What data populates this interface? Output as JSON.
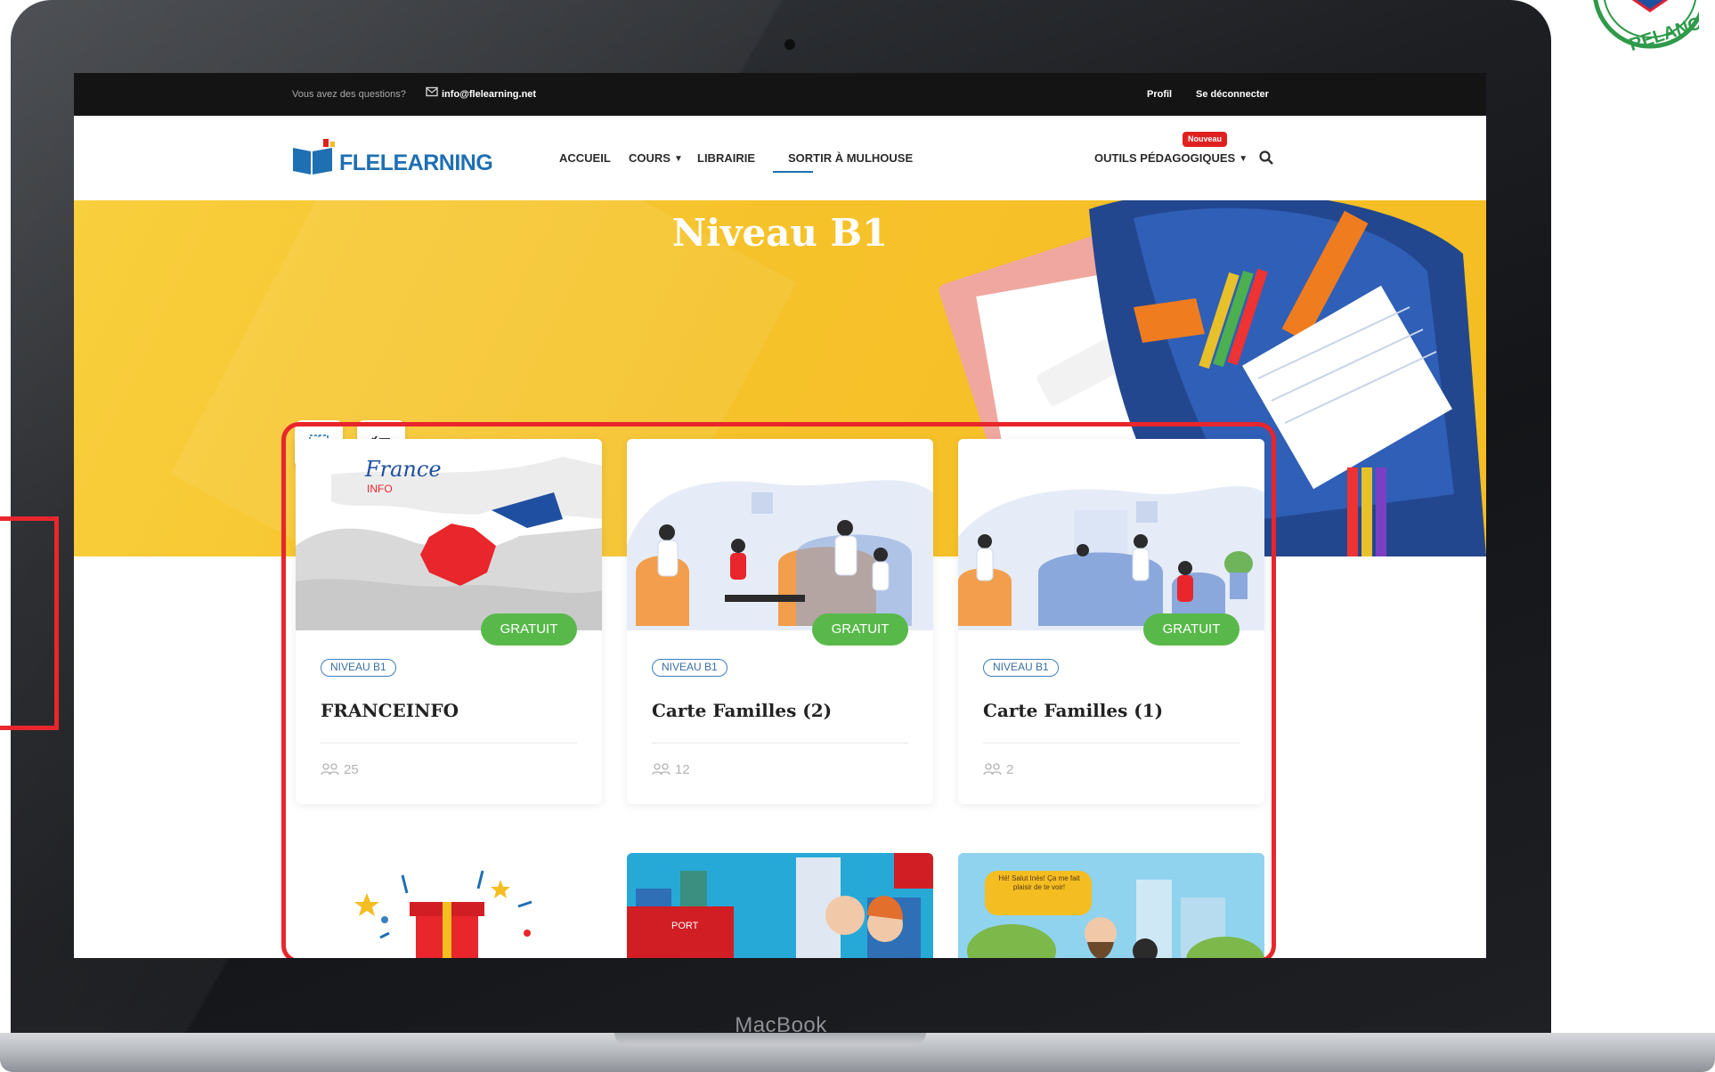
{
  "device": {
    "brand_label": "MacBook"
  },
  "topbar": {
    "question": "Vous avez des questions?",
    "email": "info@flelearning.net",
    "profile_link": "Profil",
    "logout_link": "Se déconnecter"
  },
  "header": {
    "logo_text": "FLELEARNING",
    "nav": [
      {
        "label": "ACCUEIL"
      },
      {
        "label": "COURS"
      },
      {
        "label": "LIBRAIRIE"
      },
      {
        "label": "SORTIR À MULHOUSE"
      },
      {
        "label": "OUTILS PÉDAGOGIQUES"
      }
    ],
    "new_badge": "Nouveau"
  },
  "hero": {
    "title": "Niveau B1"
  },
  "courses": [
    {
      "title": "FRANCEINFO",
      "level": "NIVEAU B1",
      "price": "GRATUIT",
      "students": "25",
      "thumb_text": "France",
      "thumb_subtext": "INFO"
    },
    {
      "title": "Carte Familles (2)",
      "level": "NIVEAU B1",
      "price": "GRATUIT",
      "students": "12"
    },
    {
      "title": "Carte Familles (1)",
      "level": "NIVEAU B1",
      "price": "GRATUIT",
      "students": "2"
    }
  ],
  "next_row": {
    "speech_bubble": "Hé! Salut Inès! Ça me fait plaisir de te voir!",
    "port_label": "PORT"
  },
  "seal": {
    "text": "RELANCE"
  },
  "colors": {
    "accent_red": "#e8262c",
    "badge_green": "#58b94a",
    "hero_yellow": "#f6c22b",
    "brand_blue": "#1f6fb3"
  }
}
